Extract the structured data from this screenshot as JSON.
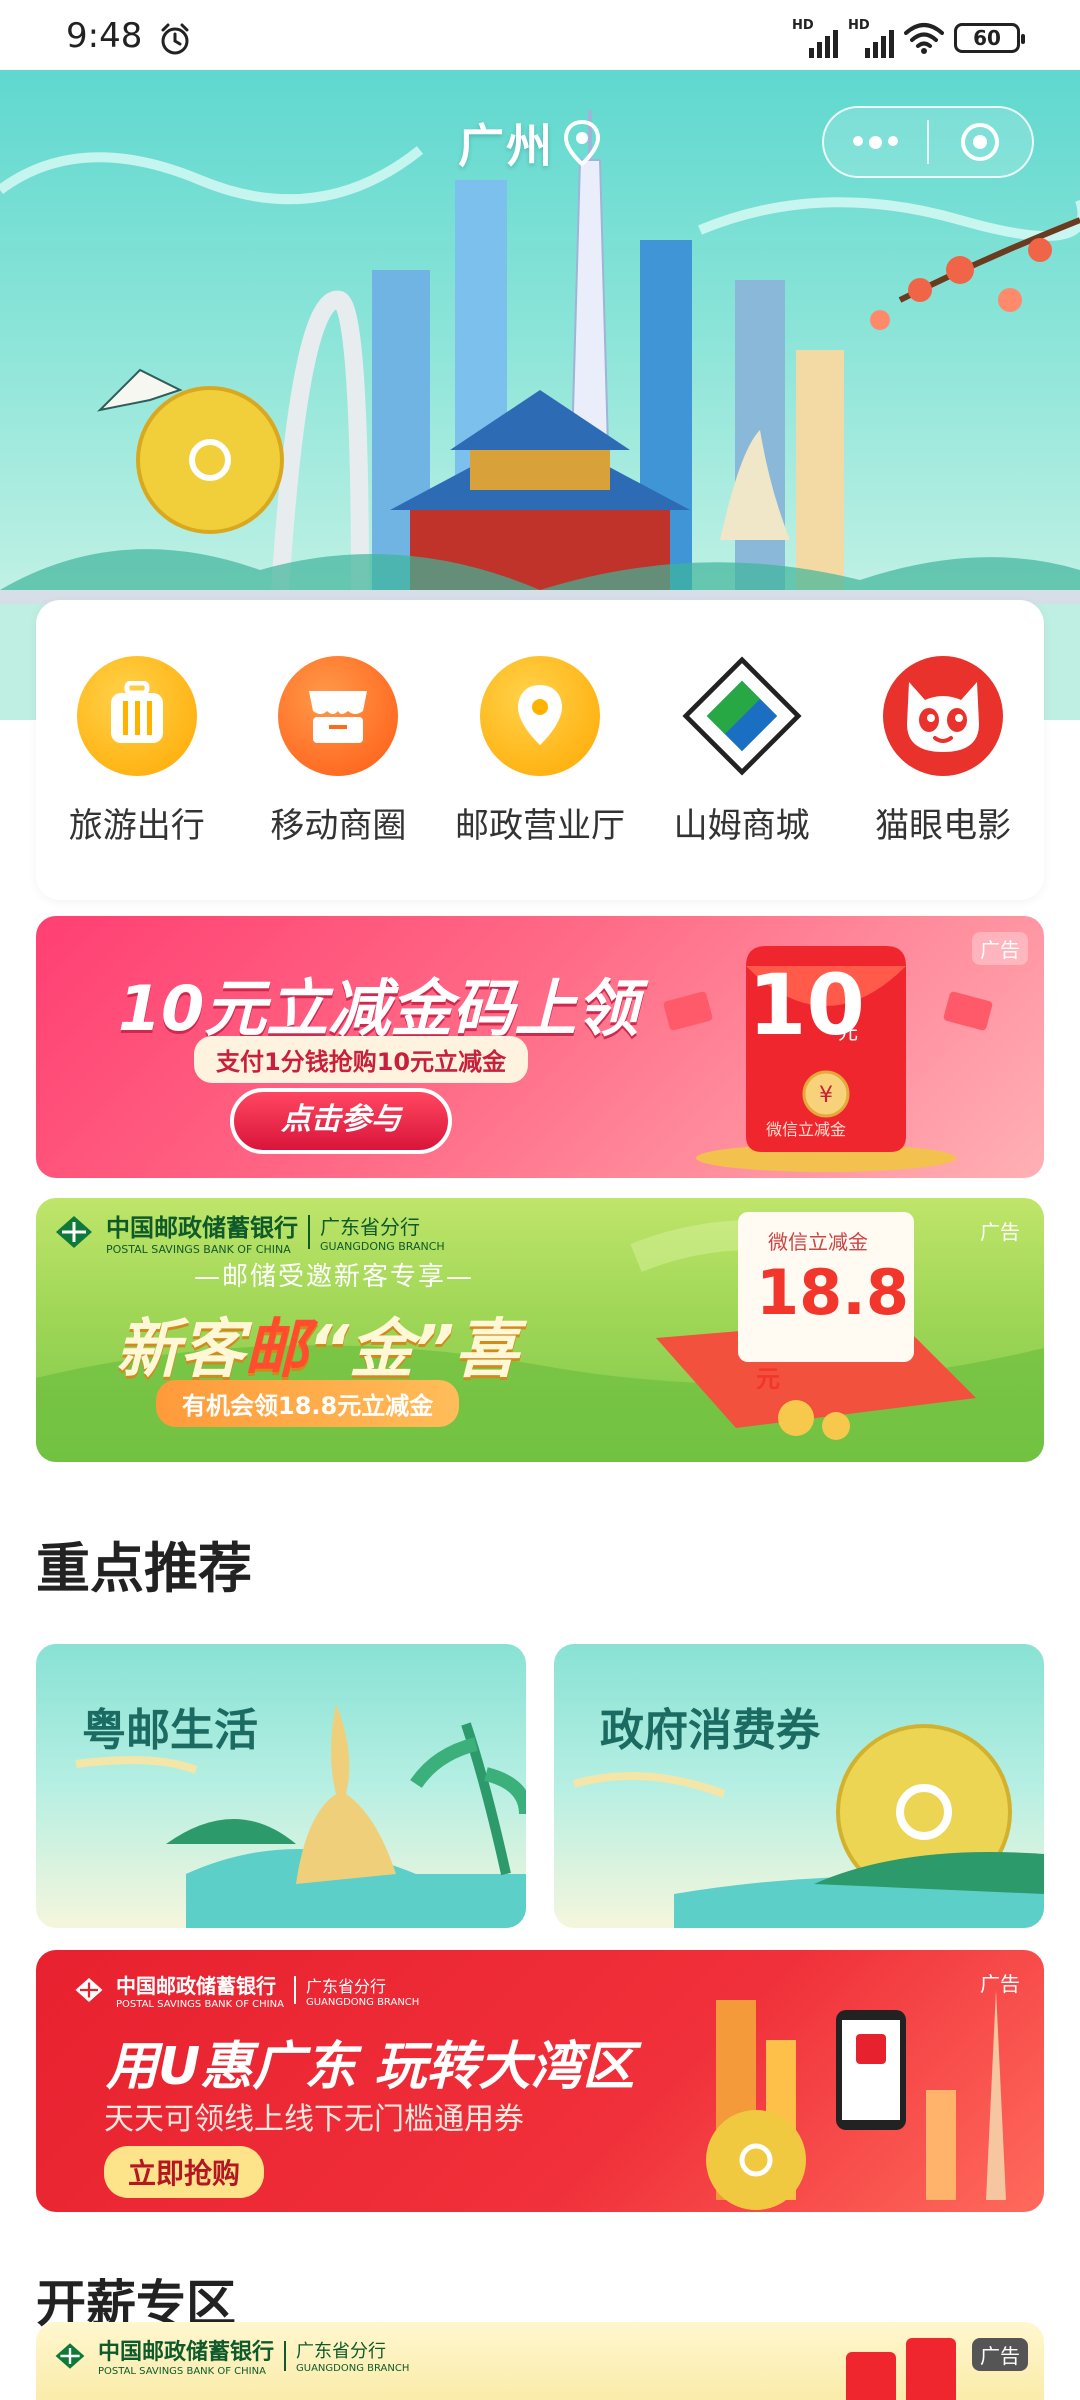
{
  "status_bar": {
    "time": "9:48",
    "network_1": "HD",
    "network_2": "HD",
    "battery": "60",
    "alarm_icon": "alarm-clock-icon",
    "wifi_icon": "wifi-icon"
  },
  "header": {
    "city": "广州",
    "location_icon": "location-pin-icon",
    "more_icon": "more-dots-icon",
    "close_icon": "target-close-icon"
  },
  "services": [
    {
      "label": "旅游出行",
      "icon": "suitcase-icon",
      "color": "#ffb300"
    },
    {
      "label": "移动商圈",
      "icon": "shop-icon",
      "color": "#ff6a1a"
    },
    {
      "label": "邮政营业厅",
      "icon": "location-pin-icon",
      "color": "#ffb300"
    },
    {
      "label": "山姆商城",
      "icon": "diamond-logo-icon",
      "color": "#1a6fc2"
    },
    {
      "label": "猫眼电影",
      "icon": "cat-face-icon",
      "color": "#e8322b"
    }
  ],
  "ad_label": "广告",
  "banner_coupon": {
    "title": "10元立减金码上领",
    "subtitle": "支付1分钱抢购10元立减金",
    "button": "点击参与",
    "envelope_amount": "10",
    "envelope_unit": "元",
    "envelope_caption": "微信立减金"
  },
  "banner_newcustomer": {
    "bank_cn": "中国邮政储蓄银行",
    "bank_en": "POSTAL SAVINGS BANK OF CHINA",
    "branch": "广东省分行",
    "branch_en": "GUANGDONG BRANCH",
    "tagline": "—邮储受邀新客专享—",
    "title_pre": "新客",
    "title_em": "邮",
    "title_post": "“金”喜",
    "subtitle": "有机会领18.8元立减金",
    "card_label": "微信立减金",
    "card_amount": "18.8",
    "card_unit": "元"
  },
  "section_recommend": {
    "title": "重点推荐",
    "cards": [
      {
        "label": "粤邮生活"
      },
      {
        "label": "政府消费券"
      }
    ]
  },
  "banner_uhui": {
    "bank_cn": "中国邮政储蓄银行",
    "bank_en": "POSTAL SAVINGS BANK OF CHINA",
    "branch": "广东省分行",
    "branch_en": "GUANGDONG BRANCH",
    "title": "用U惠广东  玩转大湾区",
    "subtitle": "天天可领线上线下无门槛通用券",
    "button": "立即抢购"
  },
  "section_salary": {
    "title": "开薪专区"
  },
  "banner_salary": {
    "bank_cn": "中国邮政储蓄银行",
    "bank_en": "POSTAL SAVINGS BANK OF CHINA",
    "branch": "广东省分行",
    "branch_en": "GUANGDONG BRANCH"
  },
  "colors": {
    "hero_sky": "#5fd8cf",
    "coupon_pink": "#ff3f72",
    "postal_green": "#0e5a2b",
    "uhui_red": "#e8212f"
  }
}
